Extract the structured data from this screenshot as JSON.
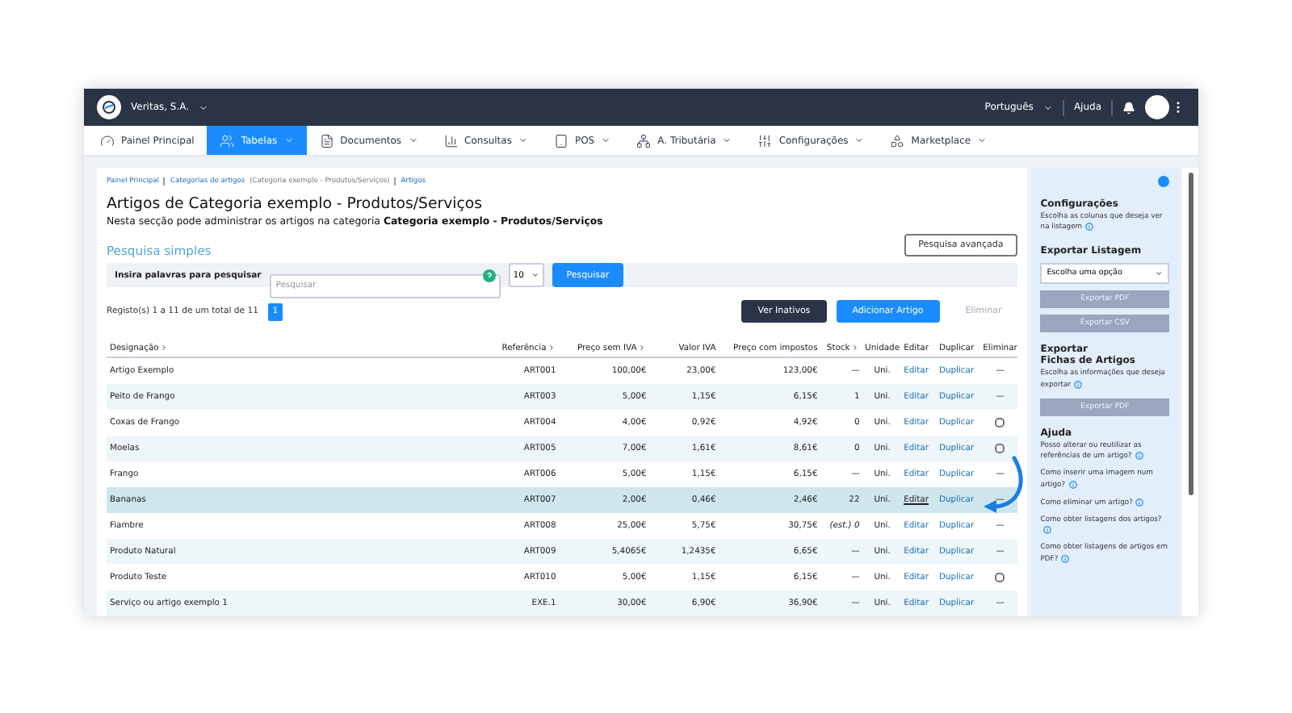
{
  "topbar": {
    "company": "Veritas, S.A.",
    "language": "Português",
    "help": "Ajuda"
  },
  "nav": [
    {
      "label": "Painel Principal",
      "kind": "dashboard",
      "selected": false,
      "dropdown": false
    },
    {
      "label": "Tabelas",
      "kind": "users",
      "selected": true,
      "dropdown": true
    },
    {
      "label": "Documentos",
      "kind": "file",
      "selected": false,
      "dropdown": true
    },
    {
      "label": "Consultas",
      "kind": "chart",
      "selected": false,
      "dropdown": true
    },
    {
      "label": "POS",
      "kind": "pos",
      "selected": false,
      "dropdown": true
    },
    {
      "label": "A. Tributária",
      "kind": "network",
      "selected": false,
      "dropdown": true
    },
    {
      "label": "Configurações",
      "kind": "sliders",
      "selected": false,
      "dropdown": true
    },
    {
      "label": "Marketplace",
      "kind": "grid",
      "selected": false,
      "dropdown": true
    }
  ],
  "breadcrumb": [
    {
      "text": "Painel Principal"
    },
    {
      "text": "Categorias de artigos",
      "note": "(Categoria exemplo - Produtos/Serviços)"
    },
    {
      "text": "Artigos"
    }
  ],
  "page": {
    "title": "Artigos de Categoria exemplo - Produtos/Serviços",
    "subtitle": "Nesta secção pode administrar os artigos na categoria **Categoria exemplo - Produtos/Serviços**"
  },
  "search": {
    "heading": "Pesquisa simples",
    "advanced_button": "Pesquisa avançada",
    "label": "Insira palavras para pesquisar",
    "placeholder": "Pesquisar",
    "page_size": "10",
    "button": "Pesquisar"
  },
  "records": {
    "summary": "Registo(s) 1 a 11 de um total de 11",
    "pages": [
      {
        "label": "1",
        "selected": true
      }
    ]
  },
  "actions": [
    {
      "label": "Ver Inativos",
      "kind": "dark"
    },
    {
      "label": "Adicionar Artigo",
      "kind": "primary"
    },
    {
      "label": "Eliminar",
      "kind": "disabled"
    }
  ],
  "table": {
    "columns": [
      {
        "label": "Designação",
        "sortable": true
      },
      {
        "label": "Referência",
        "sortable": true
      },
      {
        "label": "Preço sem IVA",
        "sortable": true
      },
      {
        "label": "Valor IVA",
        "sortable": false
      },
      {
        "label": "Preço com impostos",
        "sortable": false
      },
      {
        "label": "Stock",
        "sortable": true
      },
      {
        "label": "Unidade",
        "sortable": false
      },
      {
        "label": "Editar",
        "sortable": false
      },
      {
        "label": "Duplicar",
        "sortable": false
      },
      {
        "label": "Eliminar",
        "sortable": false
      }
    ],
    "rows": [
      {
        "name": "Artigo Exemplo",
        "ref": "ART001",
        "price": "100,00€",
        "vat": "23,00€",
        "total": "123,00€",
        "stock": "—",
        "unit": "Uni.",
        "edit": "Editar",
        "duplicate": "Duplicar",
        "delete": {
          "kind": "dash",
          "text": "—"
        },
        "selected": false
      },
      {
        "name": "Peito de Frango",
        "ref": "ART003",
        "price": "5,00€",
        "vat": "1,15€",
        "total": "6,15€",
        "stock": "1",
        "unit": "Uni.",
        "edit": "Editar",
        "duplicate": "Duplicar",
        "delete": {
          "kind": "dash",
          "text": "—"
        },
        "selected": false
      },
      {
        "name": "Coxas de Frango",
        "ref": "ART004",
        "price": "4,00€",
        "vat": "0,92€",
        "total": "4,92€",
        "stock": "0",
        "unit": "Uni.",
        "edit": "Editar",
        "duplicate": "Duplicar",
        "delete": {
          "kind": "checkbox",
          "checked": false
        },
        "selected": false
      },
      {
        "name": "Moelas",
        "ref": "ART005",
        "price": "7,00€",
        "vat": "1,61€",
        "total": "8,61€",
        "stock": "0",
        "unit": "Uni.",
        "edit": "Editar",
        "duplicate": "Duplicar",
        "delete": {
          "kind": "checkbox",
          "checked": false
        },
        "selected": false
      },
      {
        "name": "Frango",
        "ref": "ART006",
        "price": "5,00€",
        "vat": "1,15€",
        "total": "6,15€",
        "stock": "—",
        "unit": "Uni.",
        "edit": "Editar",
        "duplicate": "Duplicar",
        "delete": {
          "kind": "dash",
          "text": "—"
        },
        "selected": false
      },
      {
        "name": "Bananas",
        "ref": "ART007",
        "price": "2,00€",
        "vat": "0,46€",
        "total": "2,46€",
        "stock": "22",
        "unit": "Uni.",
        "edit": "Editar",
        "duplicate": "Duplicar",
        "delete": {
          "kind": "dash",
          "text": "—"
        },
        "selected": true
      },
      {
        "name": "Fiambre",
        "ref": "ART008",
        "price": "25,00€",
        "vat": "5,75€",
        "total": "30,75€",
        "stock": "*(est.) 0*",
        "unit": "Uni.",
        "edit": "Editar",
        "duplicate": "Duplicar",
        "delete": {
          "kind": "dash",
          "text": "—"
        },
        "selected": false
      },
      {
        "name": "Produto Natural",
        "ref": "ART009",
        "price": "5,4065€",
        "vat": "1,2435€",
        "total": "6,65€",
        "stock": "—",
        "unit": "Uni.",
        "edit": "Editar",
        "duplicate": "Duplicar",
        "delete": {
          "kind": "dash",
          "text": "—"
        },
        "selected": false
      },
      {
        "name": "Produto Teste",
        "ref": "ART010",
        "price": "5,00€",
        "vat": "1,15€",
        "total": "6,15€",
        "stock": "—",
        "unit": "Uni.",
        "edit": "Editar",
        "duplicate": "Duplicar",
        "delete": {
          "kind": "checkbox",
          "checked": false
        },
        "selected": false
      },
      {
        "name": "Serviço ou artigo exemplo 1",
        "ref": "EXE.1",
        "price": "30,00€",
        "vat": "6,90€",
        "total": "36,90€",
        "stock": "—",
        "unit": "Uni.",
        "edit": "Editar",
        "duplicate": "Duplicar",
        "delete": {
          "kind": "dash",
          "text": "—"
        },
        "selected": false
      }
    ]
  },
  "sidebar": {
    "settings": {
      "title": "Configurações",
      "text": "Escolha as colunas que deseja ver na listagem"
    },
    "export_list": {
      "title": "Exportar Listagem",
      "select_placeholder": "Escolha uma opção",
      "buttons": [
        "Exportar PDF",
        "Exportar CSV"
      ]
    },
    "export_sheets": {
      "title_lines": [
        "Exportar",
        "Fichas de Artigos"
      ],
      "text": "Escolha as informações que deseja exportar",
      "buttons": [
        "Exportar PDF"
      ]
    },
    "help": {
      "title": "Ajuda",
      "items": [
        "Posso alterar ou reutilizar as referências de um artigo?",
        "Como inserir uma imagem num artigo?",
        "Como eliminar um artigo?",
        "Como obter listagens dos artigos?",
        "Como obter listagens de artigos em PDF?"
      ]
    }
  }
}
